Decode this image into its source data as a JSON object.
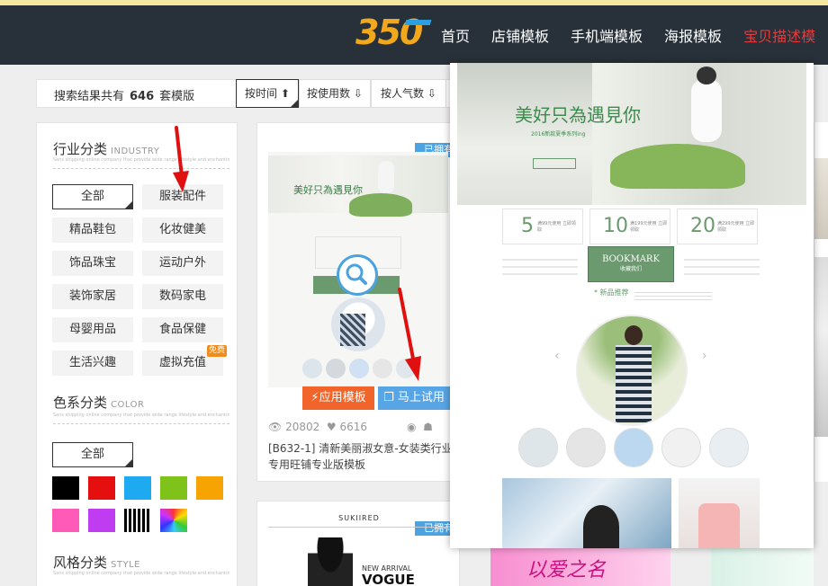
{
  "header": {
    "logo_text": "350",
    "nav": [
      {
        "label": "首页"
      },
      {
        "label": "店铺模板"
      },
      {
        "label": "手机端模板"
      },
      {
        "label": "海报模板"
      },
      {
        "label": "宝贝描述模"
      }
    ],
    "active_index": 4,
    "colors": {
      "bg": "#283039",
      "active": "#e73a3a"
    }
  },
  "sortbar": {
    "result_prefix": "搜索结果共有",
    "result_count": "646",
    "result_suffix": "套模版",
    "sorts": [
      {
        "label": "按时间",
        "icon": "arrow-up-icon",
        "active": true
      },
      {
        "label": "按使用数",
        "icon": "arrow-down-outline-icon"
      },
      {
        "label": "按人气数",
        "icon": "arrow-down-outline-icon"
      }
    ]
  },
  "filters": {
    "industry": {
      "title": "行业分类",
      "title_en": "INDUSTRY",
      "desc": "Sans shipping online company that provide wide range lifestyle and enchanting with affordable price online fashion store",
      "options": [
        "全部",
        "服装配件",
        "精品鞋包",
        "化妆健美",
        "饰品珠宝",
        "运动户外",
        "装饰家居",
        "数码家电",
        "母婴用品",
        "食品保健",
        "生活兴趣",
        "虚拟充值"
      ],
      "selected": "全部",
      "free_badge": "免费"
    },
    "color": {
      "title": "色系分类",
      "title_en": "COLOR",
      "desc": "Sans shipping online company that provide wide range lifestyle and enchanting with affordable price online fashion store",
      "all_label": "全部",
      "swatches": [
        "#000000",
        "#e60f0f",
        "#1eaaf0",
        "#7ec21a",
        "#f7a300",
        "#ff5ab8",
        "#c03cf0",
        "stripes",
        "rainbow"
      ]
    },
    "style": {
      "title": "风格分类",
      "title_en": "STYLE",
      "desc": "Sans shipping online company that provide wide range lifestyle and enchanting with affordable price online fashion store"
    }
  },
  "cards": [
    {
      "ribbon": "已拥有",
      "apply_label": "应用模板",
      "try_label": "马上试用",
      "views": "20802",
      "likes": "6616",
      "title": "[B632-1] 清新美丽淑女意-女装类行业专用旺铺专业版模板",
      "thumb_text": "美好只為遇見你"
    },
    {
      "ribbon": "已拥有",
      "thumb_brand": "SUKIIRED",
      "thumb_line1": "NEW ARRIVAL",
      "thumb_line2": "VOGUE"
    }
  ],
  "preview": {
    "headline": "美好只為遇見你",
    "subline": "2016新款夏季系列ing",
    "coupons": [
      {
        "amount": "5",
        "sub": "满99元使用 立即领取"
      },
      {
        "amount": "10",
        "sub": "满199元使用 立即领取"
      },
      {
        "amount": "20",
        "sub": "满299元使用 立即领取"
      }
    ],
    "bookmark": "BOOKMARK",
    "bookmark_sub": "收藏我们",
    "recommend": "* 新品推荐",
    "bottom_text": "以爱之名"
  },
  "colors": {
    "accent": "#4ba3e3",
    "orange": "#f1652a",
    "green": "#6a9a6e"
  }
}
